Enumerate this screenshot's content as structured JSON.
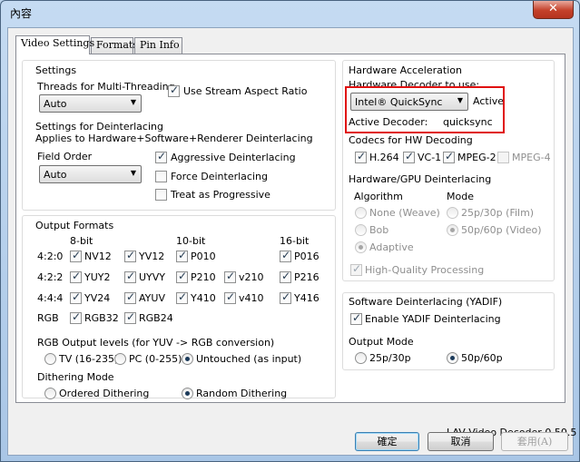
{
  "window": {
    "title": "內容",
    "close_label": "✕"
  },
  "tabs": [
    "Video Settings",
    "Formats",
    "Pin Info"
  ],
  "settings": {
    "title": "Settings",
    "threads_label": "Threads for Multi-Threading",
    "threads_value": "Auto",
    "stream_aspect": "Use Stream Aspect Ratio",
    "deint_label": "Settings for Deinterlacing",
    "deint_sub": "Applies to Hardware+Software+Renderer Deinterlacing",
    "field_order_label": "Field Order",
    "field_order_value": "Auto",
    "aggressive": "Aggressive Deinterlacing",
    "force": "Force Deinterlacing",
    "progressive": "Treat as Progressive"
  },
  "output": {
    "title": "Output Formats",
    "h8": "8-bit",
    "h10": "10-bit",
    "h16": "16-bit",
    "r420": "4:2:0",
    "r422": "4:2:2",
    "r444": "4:4:4",
    "rgb": "RGB",
    "nv12": "NV12",
    "yv12": "YV12",
    "p010": "P010",
    "p016": "P016",
    "yuy2": "YUY2",
    "uyvy": "UYVY",
    "p210": "P210",
    "v210": "v210",
    "p216": "P216",
    "yv24": "YV24",
    "ayuv": "AYUV",
    "y410": "Y410",
    "v410": "v410",
    "y416": "Y416",
    "rgb32": "RGB32",
    "rgb24": "RGB24",
    "levels_label": "RGB Output levels (for YUV -> RGB conversion)",
    "tv": "TV (16-235)",
    "pc": "PC (0-255)",
    "untouched": "Untouched (as input)",
    "dither_label": "Dithering Mode",
    "ordered": "Ordered Dithering",
    "random": "Random Dithering"
  },
  "hw": {
    "title": "Hardware Acceleration",
    "decoder_label": "Hardware Decoder to use:",
    "decoder_value": "Intel® QuickSync",
    "active": "Active",
    "active_decoder_label": "Active Decoder:",
    "active_decoder_value": "quicksync",
    "codecs_label": "Codecs for HW Decoding",
    "h264": "H.264",
    "vc1": "VC-1",
    "mpeg2": "MPEG-2",
    "mpeg4": "MPEG-4",
    "deint_label": "Hardware/GPU Deinterlacing",
    "algorithm": "Algorithm",
    "mode": "Mode",
    "weave": "None (Weave)",
    "bob": "Bob",
    "adaptive": "Adaptive",
    "film": "25p/30p (Film)",
    "video": "50p/60p (Video)",
    "hq": "High-Quality Processing"
  },
  "yadif": {
    "title": "Software Deinterlacing (YADIF)",
    "enable": "Enable YADIF Deinterlacing",
    "output_mode": "Output Mode",
    "p25": "25p/30p",
    "p50": "50p/60p"
  },
  "version": "LAV Video Decoder 0.50.5",
  "buttons": {
    "ok": "確定",
    "cancel": "取消",
    "apply": "套用(A)"
  }
}
